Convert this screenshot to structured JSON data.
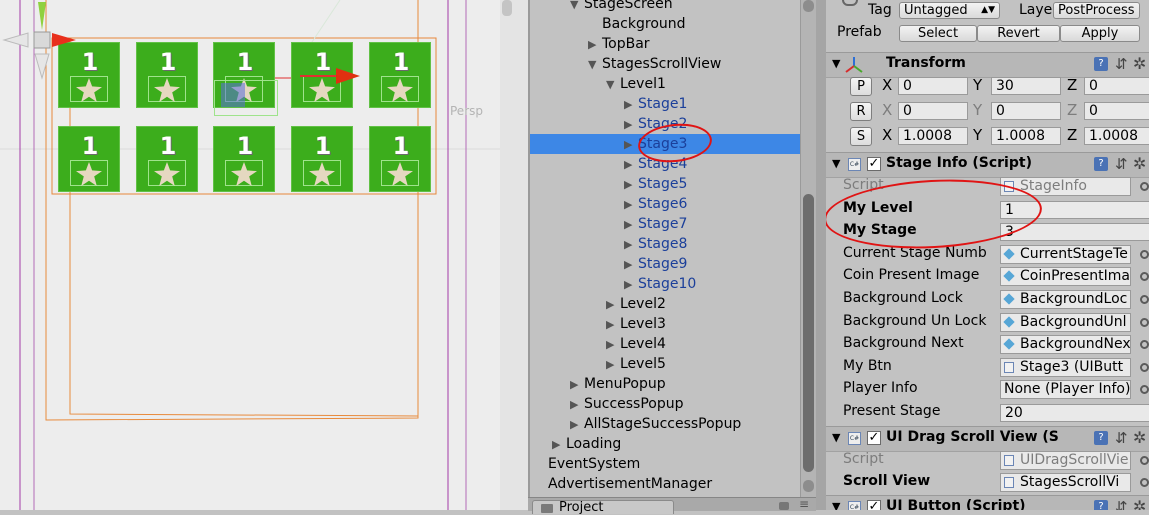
{
  "scene": {
    "persp_label": "Persp",
    "tile_number": "1",
    "tile_rows": 2,
    "tile_cols": 5
  },
  "hierarchy": {
    "items": [
      {
        "label": "StageScreen",
        "depth": 3,
        "arrow": "expanded",
        "blue": false
      },
      {
        "label": "Background",
        "depth": 4,
        "arrow": "none",
        "blue": false
      },
      {
        "label": "TopBar",
        "depth": 4,
        "arrow": "collapsed",
        "blue": false
      },
      {
        "label": "StagesScrollView",
        "depth": 4,
        "arrow": "expanded",
        "blue": false
      },
      {
        "label": "Level1",
        "depth": 5,
        "arrow": "expanded",
        "blue": false
      },
      {
        "label": "Stage1",
        "depth": 6,
        "arrow": "collapsed",
        "blue": true
      },
      {
        "label": "Stage2",
        "depth": 6,
        "arrow": "collapsed",
        "blue": true
      },
      {
        "label": "Stage3",
        "depth": 6,
        "arrow": "collapsed",
        "blue": true,
        "selected": true
      },
      {
        "label": "Stage4",
        "depth": 6,
        "arrow": "collapsed",
        "blue": true
      },
      {
        "label": "Stage5",
        "depth": 6,
        "arrow": "collapsed",
        "blue": true
      },
      {
        "label": "Stage6",
        "depth": 6,
        "arrow": "collapsed",
        "blue": true
      },
      {
        "label": "Stage7",
        "depth": 6,
        "arrow": "collapsed",
        "blue": true
      },
      {
        "label": "Stage8",
        "depth": 6,
        "arrow": "collapsed",
        "blue": true
      },
      {
        "label": "Stage9",
        "depth": 6,
        "arrow": "collapsed",
        "blue": true
      },
      {
        "label": "Stage10",
        "depth": 6,
        "arrow": "collapsed",
        "blue": true
      },
      {
        "label": "Level2",
        "depth": 5,
        "arrow": "collapsed",
        "blue": false
      },
      {
        "label": "Level3",
        "depth": 5,
        "arrow": "collapsed",
        "blue": false
      },
      {
        "label": "Level4",
        "depth": 5,
        "arrow": "collapsed",
        "blue": false
      },
      {
        "label": "Level5",
        "depth": 5,
        "arrow": "collapsed",
        "blue": false
      },
      {
        "label": "MenuPopup",
        "depth": 3,
        "arrow": "collapsed",
        "blue": false
      },
      {
        "label": "SuccessPopup",
        "depth": 3,
        "arrow": "collapsed",
        "blue": false
      },
      {
        "label": "AllStageSuccessPopup",
        "depth": 3,
        "arrow": "collapsed",
        "blue": false
      },
      {
        "label": "Loading",
        "depth": 2,
        "arrow": "collapsed",
        "blue": false
      },
      {
        "label": "EventSystem",
        "depth": 1,
        "arrow": "none",
        "blue": false
      },
      {
        "label": "AdvertisementManager",
        "depth": 1,
        "arrow": "none",
        "blue": false
      }
    ]
  },
  "project_tab": {
    "label": "Project"
  },
  "inspector": {
    "tag_label": "Tag",
    "tag_value": "Untagged",
    "layer_label": "Layer",
    "layer_value": "PostProcess",
    "prefab_label": "Prefab",
    "prefab_buttons": [
      "Select",
      "Revert",
      "Apply"
    ],
    "transform": {
      "title": "Transform",
      "position": {
        "btn": "P",
        "x": "0",
        "y": "30",
        "z": "0"
      },
      "rotation": {
        "btn": "R",
        "x": "0",
        "y": "0",
        "z": "0"
      },
      "scale": {
        "btn": "S",
        "x": "1.0008",
        "y": "1.0008",
        "z": "1.0008"
      },
      "axis_x": "X",
      "axis_y": "Y",
      "axis_z": "Z"
    },
    "stage_info": {
      "title": "Stage Info (Script)",
      "props": [
        {
          "label": "Script",
          "value": "StageInfo",
          "kind": "object",
          "icon": "script",
          "dim": true
        },
        {
          "label": "My Level",
          "value": "1",
          "kind": "text",
          "bold": true
        },
        {
          "label": "My Stage",
          "value": "3",
          "kind": "text",
          "bold": true
        },
        {
          "label": "Current Stage Numb",
          "value": "CurrentStageTe",
          "kind": "object",
          "icon": "cube"
        },
        {
          "label": "Coin Present Image",
          "value": "CoinPresentIma",
          "kind": "object",
          "icon": "cube"
        },
        {
          "label": "Background Lock",
          "value": "BackgroundLoc",
          "kind": "object",
          "icon": "cube"
        },
        {
          "label": "Background Un Lock",
          "value": "BackgroundUnl",
          "kind": "object",
          "icon": "cube"
        },
        {
          "label": "Background Next",
          "value": "BackgroundNex",
          "kind": "object",
          "icon": "cube"
        },
        {
          "label": "My Btn",
          "value": "Stage3 (UIButt",
          "kind": "object",
          "icon": "script"
        },
        {
          "label": "Player Info",
          "value": "None (Player Info)",
          "kind": "object",
          "icon": "none"
        },
        {
          "label": "Present Stage",
          "value": "20",
          "kind": "text"
        }
      ]
    },
    "drag_scroll": {
      "title": "UI Drag Scroll View (S",
      "props": [
        {
          "label": "Script",
          "value": "UIDragScrollVie",
          "kind": "object",
          "icon": "script",
          "dim": true
        },
        {
          "label": "Scroll View",
          "value": "StagesScrollVi",
          "kind": "object",
          "icon": "script",
          "bold": true
        }
      ]
    },
    "ui_button": {
      "title": "UI Button (Script)"
    },
    "colors": {
      "annotation": "#e01414",
      "selection": "#3d87e6",
      "tile_green": "#3cad1c"
    }
  }
}
